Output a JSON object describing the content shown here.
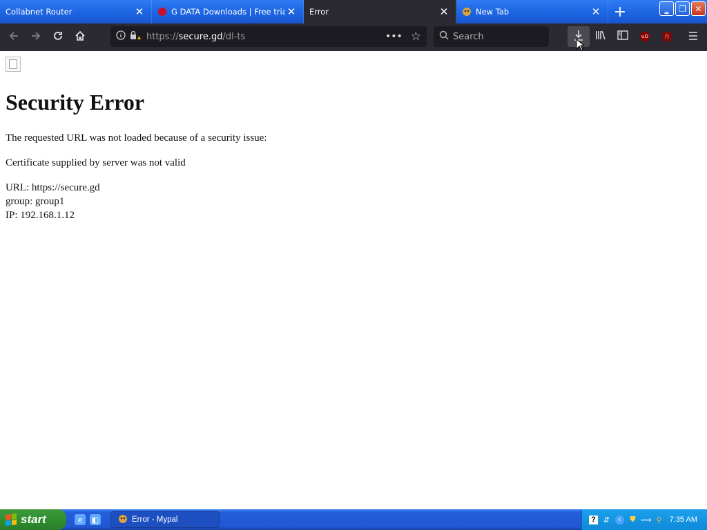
{
  "tabs": [
    {
      "title": "Collabnet Router",
      "close": "✕"
    },
    {
      "title": "G DATA Downloads | Free trials, u",
      "close": "✕"
    },
    {
      "title": "Error",
      "close": "✕"
    },
    {
      "title": "New Tab",
      "close": "✕"
    }
  ],
  "new_tab": "+",
  "window_controls": {
    "minimize": "‗",
    "restore": "❐",
    "close": "✕"
  },
  "nav": {
    "back_icon": "arrow-left",
    "forward_icon": "arrow-right",
    "reload_icon": "reload",
    "home_icon": "home"
  },
  "urlbar": {
    "scheme": "https://",
    "host": "secure.gd",
    "path": "/dl-ts",
    "more": "•••",
    "bookmark": "☆"
  },
  "search": {
    "placeholder": "Search"
  },
  "toolbar": {
    "ublock_label": "uO",
    "h_label": "h"
  },
  "page": {
    "heading": "Security Error",
    "intro": "The requested URL was not loaded because of a security issue:",
    "reason": "Certificate supplied by server was not valid",
    "url_line": "URL: https://secure.gd",
    "group_line": "group: group1",
    "ip_line": "IP: 192.168.1.12"
  },
  "taskbar": {
    "start": "start",
    "active_window": "Error - Mypal",
    "clock": "7:35 AM"
  },
  "colors": {
    "tabbar": "#1e66e3",
    "active_tab": "#2b2a33",
    "navbar": "#2b2a33",
    "taskbar": "#245edb",
    "start": "#2f8f2f",
    "tray": "#0f8ad8"
  }
}
